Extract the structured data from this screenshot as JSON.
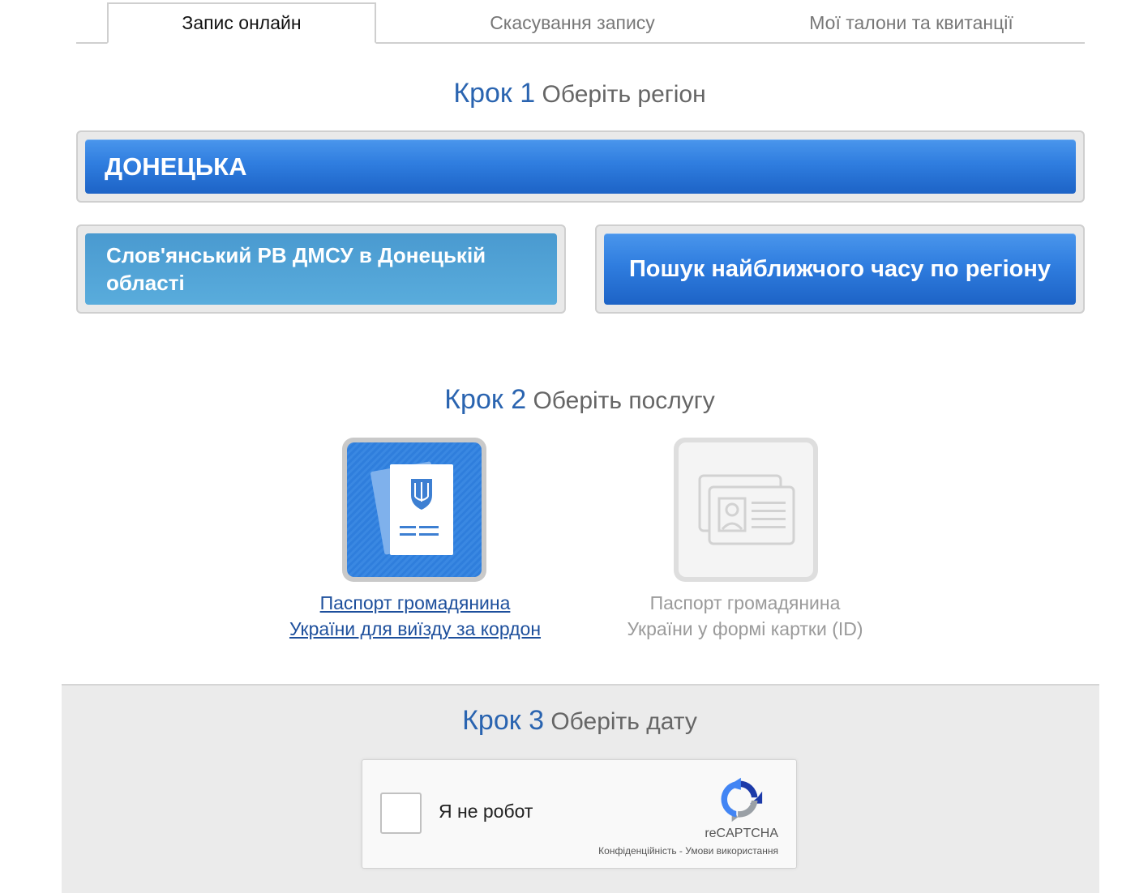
{
  "tabs": [
    {
      "label": "Запис онлайн"
    },
    {
      "label": "Скасування запису"
    },
    {
      "label": "Мої талони та квитанції"
    }
  ],
  "step1": {
    "number": "Крок 1",
    "title": "Оберіть регіон"
  },
  "region": {
    "selected": "ДОНЕЦЬКА"
  },
  "office": {
    "label": "Слов'янський РВ ДМСУ в Донецькій області"
  },
  "nearest_time_button": "Пошук найближчого часу по регіону",
  "step2": {
    "number": "Крок 2",
    "title": "Оберіть послугу"
  },
  "services": [
    {
      "label_line1": "Паспорт громадянина",
      "label_line2": "України для виїзду за кордон",
      "icon": "passport-icon",
      "enabled": true
    },
    {
      "label_line1": "Паспорт громадянина",
      "label_line2": "України у формі картки (ID)",
      "icon": "id-card-icon",
      "enabled": false
    }
  ],
  "step3": {
    "number": "Крок 3",
    "title": "Оберіть дату"
  },
  "captcha": {
    "label": "Я не робот",
    "brand": "reCAPTCHA",
    "privacy": "Конфіденційність",
    "separator": " - ",
    "terms": "Умови використання"
  },
  "colors": {
    "accent": "#2a64b0",
    "button_blue": "#2f7ddf",
    "button_light": "#52a3d6"
  }
}
